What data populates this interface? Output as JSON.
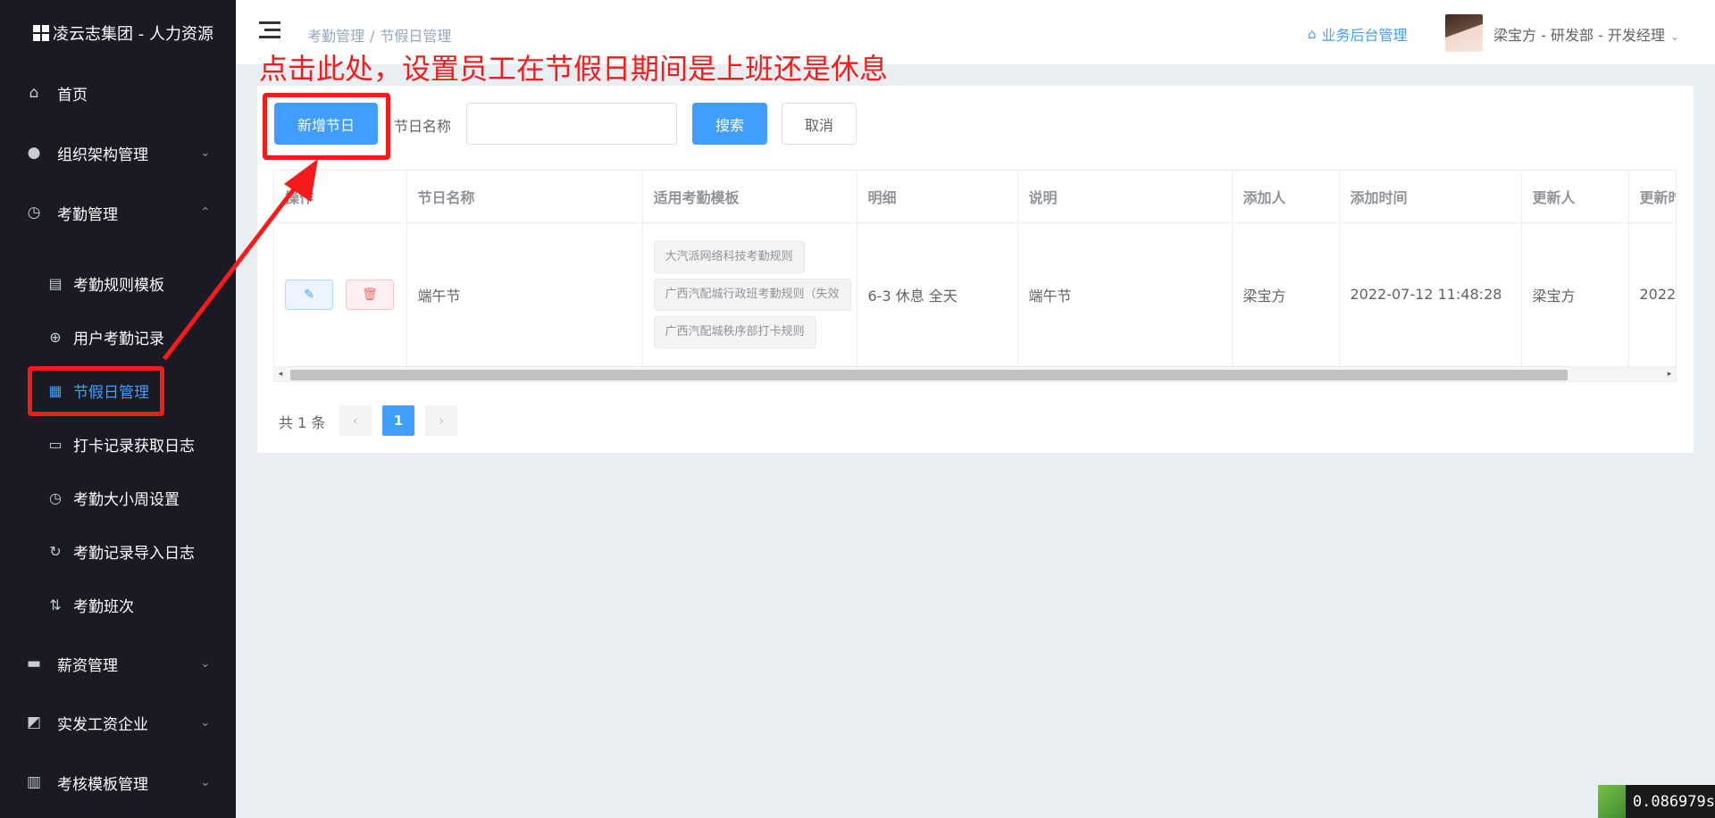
{
  "sidebar": {
    "brand": "凌云志集团 - 人力资源",
    "menu": [
      {
        "label": "首页",
        "icon": "home-icon",
        "arrow": ""
      },
      {
        "label": "组织架构管理",
        "icon": "user-icon",
        "arrow": "⌄"
      },
      {
        "label": "考勤管理",
        "icon": "clock-icon",
        "arrow": "⌃"
      },
      {
        "label": "薪资管理",
        "icon": "wallet-icon",
        "arrow": "⌄"
      },
      {
        "label": "实发工资企业",
        "icon": "chart-icon",
        "arrow": "⌄"
      },
      {
        "label": "考核模板管理",
        "icon": "book-icon",
        "arrow": "⌄"
      }
    ],
    "submenu": [
      {
        "label": "考勤规则模板",
        "icon": "form-icon"
      },
      {
        "label": "用户考勤记录",
        "icon": "compass-icon"
      },
      {
        "label": "节假日管理",
        "icon": "calendar-icon"
      },
      {
        "label": "打卡记录获取日志",
        "icon": "document-icon"
      },
      {
        "label": "考勤大小周设置",
        "icon": "clock-icon"
      },
      {
        "label": "考勤记录导入日志",
        "icon": "refresh-icon"
      },
      {
        "label": "考勤班次",
        "icon": "sort-icon"
      }
    ]
  },
  "header": {
    "breadcrumb": [
      "考勤管理",
      "节假日管理"
    ],
    "breadcrumb_sep": "/",
    "biz_link": "业务后台管理",
    "user": "梁宝方 - 研发部 - 开发经理"
  },
  "toolbar": {
    "add_label": "新增节日",
    "search_label": "节日名称",
    "search_value": "",
    "search_button": "搜索",
    "cancel_button": "取消"
  },
  "table": {
    "columns": [
      "操作",
      "节日名称",
      "适用考勤模板",
      "明细",
      "说明",
      "添加人",
      "添加时间",
      "更新人",
      "更新时间"
    ],
    "rows": [
      {
        "name": "端午节",
        "templates": [
          "大汽派网络科技考勤规则",
          "广西汽配城行政班考勤规则（失效",
          "广西汽配城秩序部打卡规则"
        ],
        "detail": "6-3 休息 全天",
        "desc": "端午节",
        "creator": "梁宝方",
        "created": "2022-07-12 11:48:28",
        "updater": "梁宝方",
        "updated": "2022-"
      }
    ]
  },
  "pagination": {
    "total": "共 1 条",
    "current": "1"
  },
  "annotation": {
    "text": "点击此处，设置员工在节假日期间是上班还是休息",
    "color": "#f51b1b"
  },
  "timer": "0.086979s",
  "colors": {
    "primary": "#409eff",
    "sidebar_bg": "#191a23",
    "annotation": "#f51b1b"
  }
}
